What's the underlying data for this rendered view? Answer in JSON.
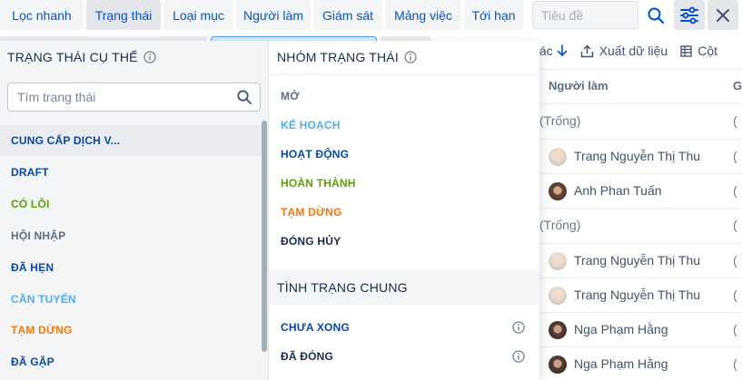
{
  "filter_tabs": [
    {
      "label": "Lọc nhanh",
      "active": false
    },
    {
      "label": "Trạng thái",
      "active": true
    },
    {
      "label": "Loại mục",
      "active": false
    },
    {
      "label": "Người làm",
      "active": false
    },
    {
      "label": "Giám sát",
      "active": false
    },
    {
      "label": "Mảng việc",
      "active": false
    },
    {
      "label": "Tới hạn",
      "active": false
    }
  ],
  "search": {
    "placeholder": "Tiêu đề"
  },
  "toolbar_icons": [
    "search-icon",
    "filter-settings-icon",
    "close-icon"
  ],
  "table": {
    "toolbar": {
      "sort_label": "tác",
      "export_label": "Xuất dữ liệu",
      "columns_label": "Cột"
    },
    "columns": [
      "Người làm",
      "G"
    ],
    "rows": [
      {
        "assignee": "(Trống)",
        "avatar": null,
        "g": "("
      },
      {
        "assignee": "Trang Nguyễn Thị Thu",
        "avatar": "avatar-trang",
        "g": "("
      },
      {
        "assignee": "Anh Phan Tuấn",
        "avatar": "avatar-anh",
        "g": "("
      },
      {
        "assignee": "(Trống)",
        "avatar": null,
        "g": "("
      },
      {
        "assignee": "Trang Nguyễn Thị Thu",
        "avatar": "avatar-trang",
        "g": "("
      },
      {
        "assignee": "Trang Nguyễn Thị Thu",
        "avatar": "avatar-trang",
        "g": "("
      },
      {
        "assignee": "Nga Phạm Hằng",
        "avatar": "avatar-nga",
        "g": "("
      },
      {
        "assignee": "Nga Phạm Hằng",
        "avatar": "avatar-nga",
        "g": "("
      }
    ]
  },
  "dropdown": {
    "specific_title": "TRẠNG THÁI CỤ THỂ",
    "status_search_placeholder": "Tìm trạng thái",
    "statuses": [
      {
        "label": "CUNG CẤP DỊCH V...",
        "color": "#0747a6",
        "hover": true
      },
      {
        "label": "DRAFT",
        "color": "#0747a6"
      },
      {
        "label": "CÓ LỖI",
        "color": "#5ba300"
      },
      {
        "label": "HỘI NHẬP",
        "color": "#5e6c84"
      },
      {
        "label": "ĐÃ HẸN",
        "color": "#0747a6"
      },
      {
        "label": "CẦN TUYỂN",
        "color": "#4fadf3"
      },
      {
        "label": "TẠM DỪNG",
        "color": "#f4780b"
      },
      {
        "label": "ĐÃ GẶP",
        "color": "#0747a6"
      }
    ],
    "group_title": "NHÓM TRẠNG THÁI",
    "groups": [
      {
        "label": "MỞ",
        "color": "#5e6c84"
      },
      {
        "label": "KẾ HOẠCH",
        "color": "#4fadf3"
      },
      {
        "label": "HOẠT ĐỘNG",
        "color": "#0747a6"
      },
      {
        "label": "HOÀN THÀNH",
        "color": "#5ba300"
      },
      {
        "label": "TẠM DỪNG",
        "color": "#f4780b"
      },
      {
        "label": "ĐÓNG HỦY",
        "color": "#172b4d"
      }
    ],
    "general_title": "TÌNH TRẠNG CHUNG",
    "general": [
      {
        "label": "CHƯA XONG",
        "color": "#0747a6"
      },
      {
        "label": "ĐÃ ĐÓNG",
        "color": "#172b4d"
      }
    ]
  },
  "colors": {
    "accent": "#0052cc",
    "tab_bg": "#f4f5f7",
    "active_tab_bg": "#e4e6ea"
  }
}
